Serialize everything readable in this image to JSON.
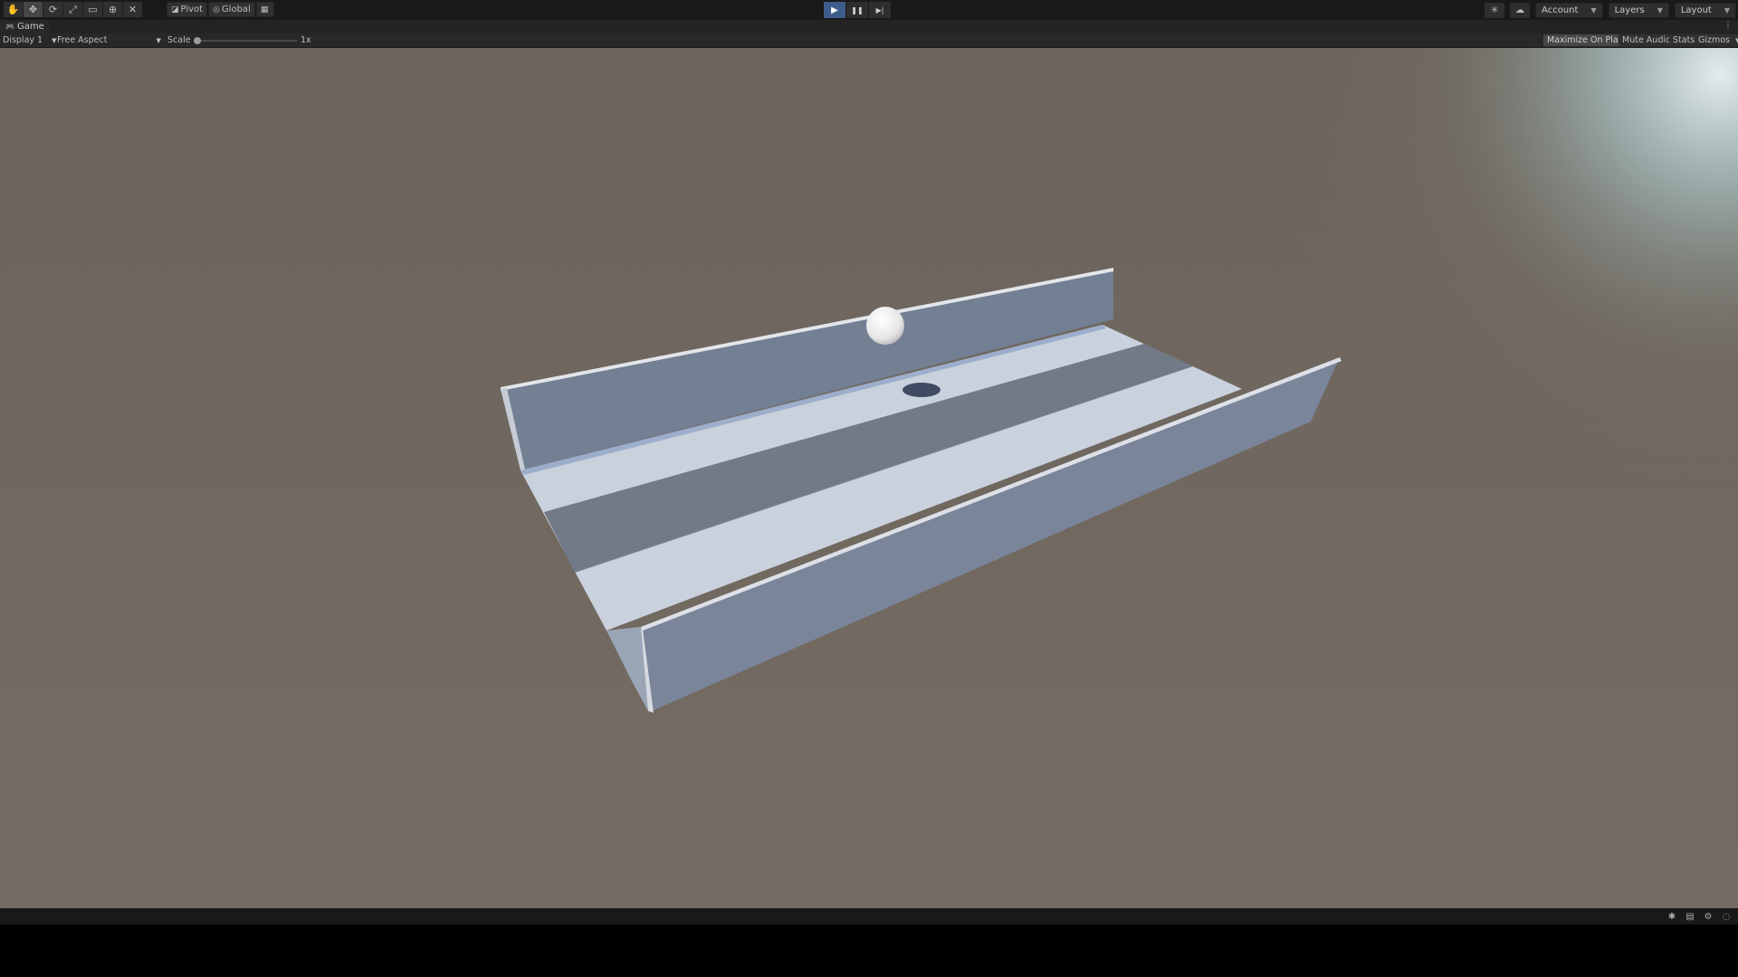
{
  "toolbar": {
    "tools": [
      {
        "name": "hand-tool",
        "icon": "✋"
      },
      {
        "name": "move-tool",
        "icon": "✥"
      },
      {
        "name": "rotate-tool",
        "icon": "⟳"
      },
      {
        "name": "scale-tool",
        "icon": "⤢"
      },
      {
        "name": "rect-tool",
        "icon": "▭"
      },
      {
        "name": "transform-tool",
        "icon": "⊕"
      },
      {
        "name": "custom-tool",
        "icon": "✕"
      }
    ],
    "pivot_label": "Pivot",
    "global_label": "Global",
    "grid_icon": "grid-icon"
  },
  "playmode": {
    "play_icon": "▶",
    "pause_icon": "❚❚",
    "step_icon": "▶|"
  },
  "right_controls": {
    "account_label": "Account",
    "layers_label": "Layers",
    "layout_label": "Layout"
  },
  "tab": {
    "label": "Game"
  },
  "game_toolbar": {
    "display_label": "Display 1",
    "aspect_label": "Free Aspect",
    "scale_label": "Scale",
    "scale_value": "1x",
    "maximize_label": "Maximize On Play",
    "mute_label": "Mute Audio",
    "stats_label": "Stats",
    "gizmos_label": "Gizmos"
  },
  "scene": {
    "background_color": "#6e665e",
    "track_color": "#c8d0dc",
    "wall_color": "#7c879a",
    "ball_color": "#f2f2f2"
  }
}
